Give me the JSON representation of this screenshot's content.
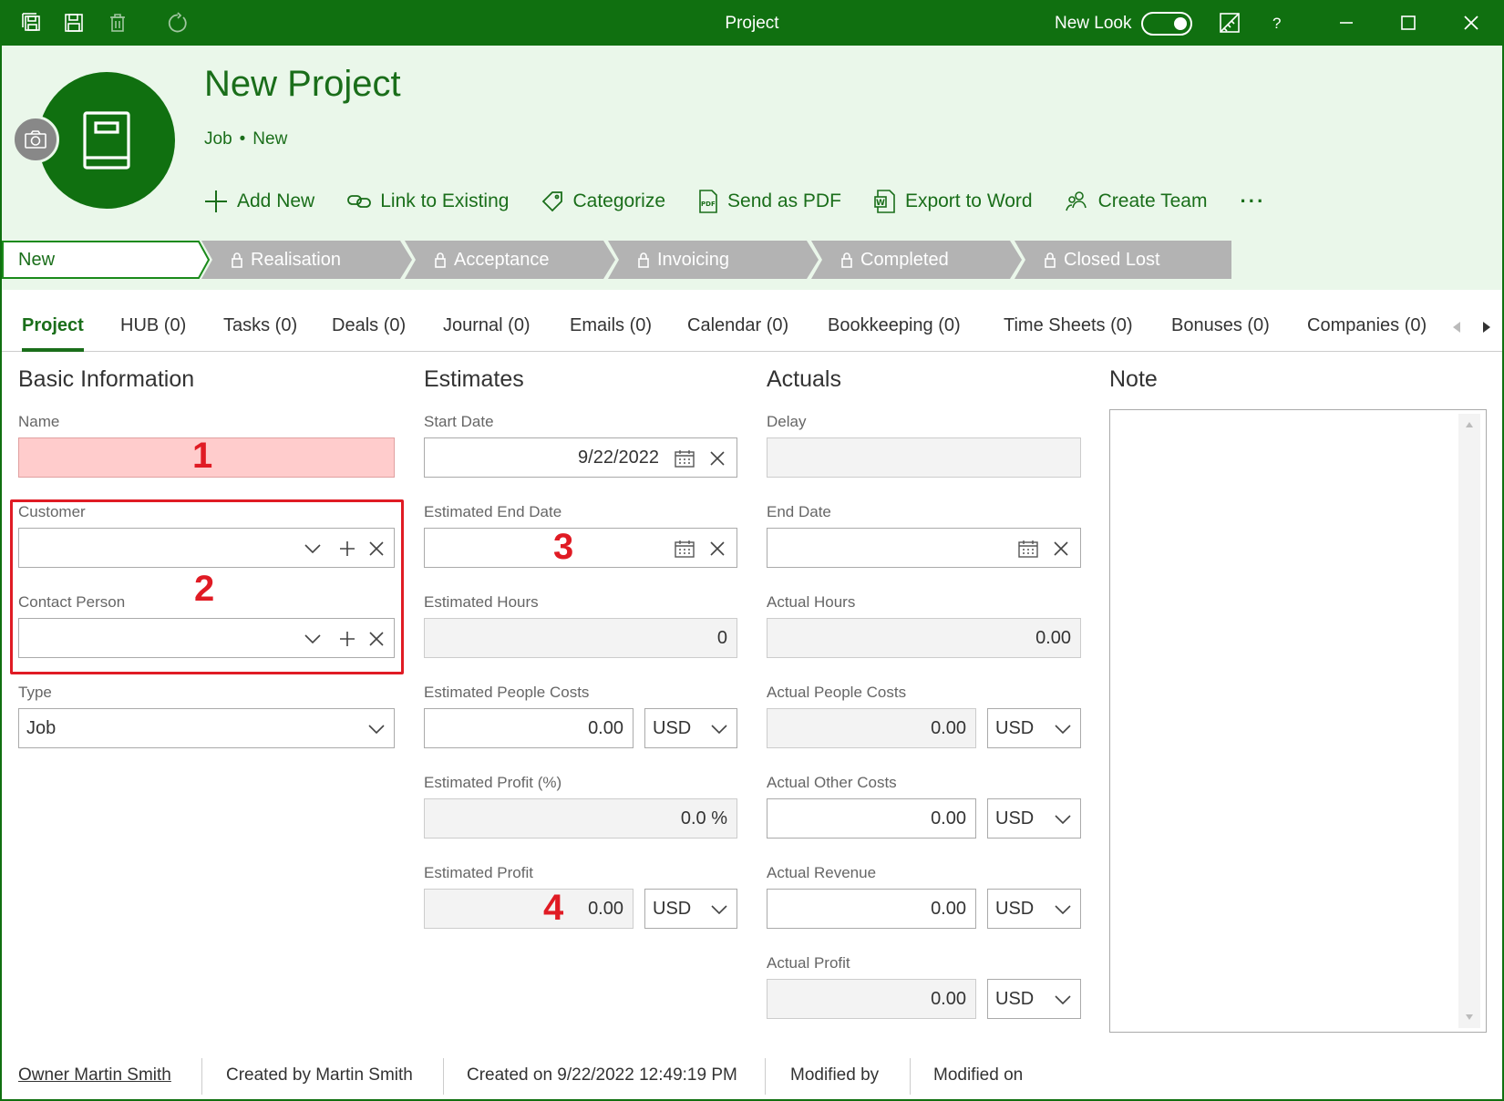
{
  "window": {
    "title": "Project",
    "new_look_label": "New Look",
    "help_label": "?",
    "new_look_enabled": true
  },
  "header": {
    "title": "New Project",
    "type": "Job",
    "status": "New",
    "actions": {
      "add_new": "Add New",
      "link_existing": "Link to Existing",
      "categorize": "Categorize",
      "send_pdf": "Send as PDF",
      "export_word": "Export to Word",
      "create_team": "Create Team",
      "more": "···"
    }
  },
  "stages": [
    "New",
    "Realisation",
    "Acceptance",
    "Invoicing",
    "Completed",
    "Closed Lost"
  ],
  "tabs": [
    "Project",
    "HUB (0)",
    "Tasks (0)",
    "Deals (0)",
    "Journal (0)",
    "Emails (0)",
    "Calendar (0)",
    "Bookkeeping (0)",
    "Time Sheets (0)",
    "Bonuses (0)",
    "Companies (0)"
  ],
  "basic": {
    "title": "Basic Information",
    "name_label": "Name",
    "name_value": "",
    "customer_label": "Customer",
    "contact_label": "Contact Person",
    "type_label": "Type",
    "type_value": "Job"
  },
  "estimates": {
    "title": "Estimates",
    "start_date_label": "Start Date",
    "start_date_value": "9/22/2022",
    "end_date_label": "Estimated End Date",
    "hours_label": "Estimated Hours",
    "hours_value": "0",
    "people_costs_label": "Estimated People Costs",
    "people_costs_value": "0.00",
    "people_costs_currency": "USD",
    "profit_pct_label": "Estimated Profit (%)",
    "profit_pct_value": "0.0 %",
    "profit_label": "Estimated Profit",
    "profit_value": "0.00",
    "profit_currency": "USD"
  },
  "actuals": {
    "title": "Actuals",
    "delay_label": "Delay",
    "end_date_label": "End Date",
    "hours_label": "Actual Hours",
    "hours_value": "0.00",
    "people_costs_label": "Actual People Costs",
    "people_costs_value": "0.00",
    "people_costs_currency": "USD",
    "other_costs_label": "Actual Other Costs",
    "other_costs_value": "0.00",
    "other_costs_currency": "USD",
    "revenue_label": "Actual Revenue",
    "revenue_value": "0.00",
    "revenue_currency": "USD",
    "profit_label": "Actual Profit",
    "profit_value": "0.00",
    "profit_currency": "USD"
  },
  "note": {
    "title": "Note"
  },
  "annotations": [
    "1",
    "2",
    "3",
    "4"
  ],
  "footer": {
    "owner": "Owner Martin Smith",
    "created_by": "Created by Martin Smith",
    "created_on": "Created on 9/22/2022 12:49:19 PM",
    "modified_by": "Modified by",
    "modified_on": "Modified on"
  },
  "colors": {
    "brand_green": "#107010",
    "header_bg": "#eaf7ea",
    "stage_inactive": "#b3b3b3",
    "error_field": "#ffcccc",
    "annotation_red": "#e01b24"
  }
}
